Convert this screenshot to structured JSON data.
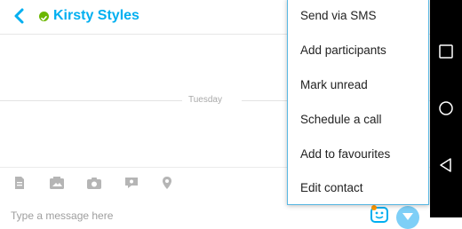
{
  "header": {
    "contact_name": "Kirsty Styles",
    "presence_color": "#6bb700",
    "accent_color": "#00aff0"
  },
  "conversation": {
    "date_divider": "Tuesday"
  },
  "compose": {
    "placeholder": "Type a message here",
    "icons": [
      "file-icon",
      "media-icon",
      "camera-icon",
      "video-message-icon",
      "location-icon"
    ]
  },
  "menu": {
    "items": [
      "Send via SMS",
      "Add participants",
      "Mark unread",
      "Schedule a call",
      "Add to favourites",
      "Edit contact"
    ],
    "border_color": "#58b7e3"
  },
  "navbar": {
    "buttons": [
      "recents-icon",
      "home-icon",
      "back-icon"
    ]
  }
}
